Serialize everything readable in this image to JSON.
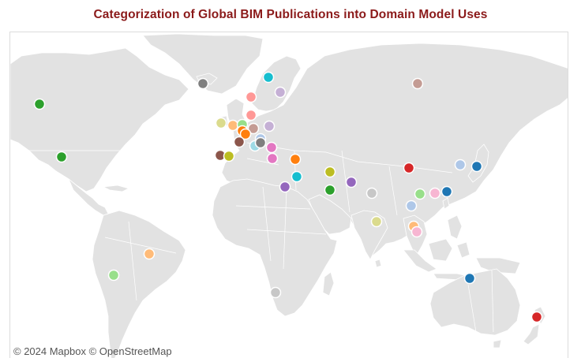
{
  "title": "Categorization of Global BIM Publications into Domain Model Uses",
  "attribution": "© 2024 Mapbox  © OpenStreetMap",
  "colors": {
    "title": "#8b1a1a",
    "land": "#e2e2e2",
    "border": "#ffffff",
    "water": "#ffffff"
  },
  "markers": [
    {
      "name": "alaska",
      "color": "#7f7f7f"
    },
    {
      "name": "canada",
      "color": "#2ca02c"
    },
    {
      "name": "usa",
      "color": "#2ca02c"
    },
    {
      "name": "brazil",
      "color": "#ffbb78"
    },
    {
      "name": "chile",
      "color": "#98df8a"
    },
    {
      "name": "norway",
      "color": "#17becf"
    },
    {
      "name": "sweden",
      "color": "#c5b0d5"
    },
    {
      "name": "uk",
      "color": "#ff9896"
    },
    {
      "name": "denmark",
      "color": "#ff9896"
    },
    {
      "name": "ireland",
      "color": "#dbdb8d"
    },
    {
      "name": "belgium",
      "color": "#ffbb78"
    },
    {
      "name": "netherlands",
      "color": "#98df8a"
    },
    {
      "name": "germany",
      "color": "#c49c94"
    },
    {
      "name": "poland",
      "color": "#c5b0d5"
    },
    {
      "name": "france-1",
      "color": "#ff7f0e"
    },
    {
      "name": "france-2",
      "color": "#ff7f0e"
    },
    {
      "name": "switzerland",
      "color": "#8c564b"
    },
    {
      "name": "austria",
      "color": "#aec7e8"
    },
    {
      "name": "slovenia",
      "color": "#9edae5"
    },
    {
      "name": "czechia",
      "color": "#7f7f7f"
    },
    {
      "name": "serbia",
      "color": "#e377c2"
    },
    {
      "name": "portugal",
      "color": "#8c564b"
    },
    {
      "name": "spain",
      "color": "#bcbd22"
    },
    {
      "name": "italy",
      "color": "#e377c2"
    },
    {
      "name": "turkey",
      "color": "#ff7f0e"
    },
    {
      "name": "egypt",
      "color": "#9467bd"
    },
    {
      "name": "jordan",
      "color": "#17becf"
    },
    {
      "name": "iraq",
      "color": "#bcbd22"
    },
    {
      "name": "saudi-arabia",
      "color": "#2ca02c"
    },
    {
      "name": "pakistan",
      "color": "#9467bd"
    },
    {
      "name": "india",
      "color": "#c7c7c7"
    },
    {
      "name": "sri-lanka",
      "color": "#dbdb8d"
    },
    {
      "name": "russia",
      "color": "#c49c94"
    },
    {
      "name": "china",
      "color": "#d62728"
    },
    {
      "name": "korea",
      "color": "#aec7e8"
    },
    {
      "name": "japan",
      "color": "#1f77b4"
    },
    {
      "name": "vietnam",
      "color": "#98df8a"
    },
    {
      "name": "hong-kong",
      "color": "#f7b6d2"
    },
    {
      "name": "taiwan",
      "color": "#1f77b4"
    },
    {
      "name": "thailand",
      "color": "#aec7e8"
    },
    {
      "name": "malaysia",
      "color": "#ffbb78"
    },
    {
      "name": "singapore",
      "color": "#f7b6d2"
    },
    {
      "name": "south-africa",
      "color": "#c7c7c7"
    },
    {
      "name": "australia",
      "color": "#1f77b4"
    },
    {
      "name": "new-zealand",
      "color": "#d62728"
    }
  ]
}
